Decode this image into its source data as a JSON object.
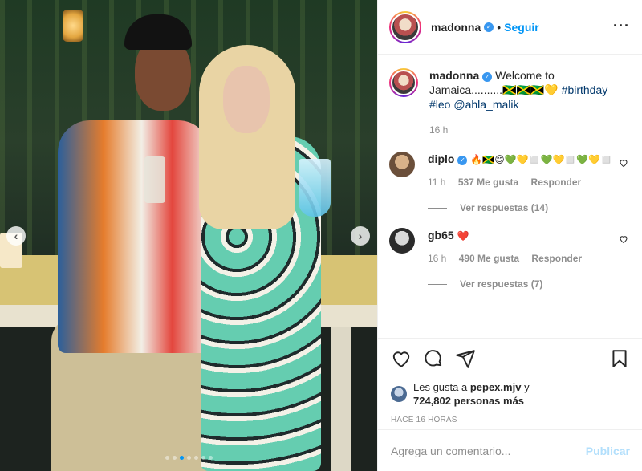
{
  "post": {
    "username": "madonna",
    "separator": "•",
    "follow_label": "Seguir",
    "more_icon": "more-icon"
  },
  "caption": {
    "username": "madonna",
    "text": "Welcome to Jamaica..........🇯🇲🇯🇲🇯🇲💛",
    "hashtags": "#birthday #leo",
    "mention": "@ahla_malik",
    "time": "16 h"
  },
  "comments": [
    {
      "username": "diplo",
      "text": "🔥🇯🇲😊💚💛◻️💚💛◻️💚💛◻️",
      "time": "11 h",
      "likes": "537 Me gusta",
      "reply": "Responder",
      "view_replies": "Ver respuestas (14)"
    },
    {
      "username": "gb65",
      "text": "❤️",
      "time": "16 h",
      "likes": "490 Me gusta",
      "reply": "Responder",
      "view_replies": "Ver respuestas (7)"
    }
  ],
  "likes": {
    "prefix": "Les gusta a",
    "user": "pepex.mjv",
    "conj": "y",
    "count": "724,802 personas más",
    "time": "HACE 16 HORAS"
  },
  "composer": {
    "placeholder": "Agrega un comentario...",
    "publish_label": "Publicar"
  },
  "carousel": {
    "slide_count": 7,
    "active_slide": 2
  },
  "colors": {
    "link": "#0095f6",
    "verified": "#3897f0",
    "muted": "#8e8e8e"
  }
}
